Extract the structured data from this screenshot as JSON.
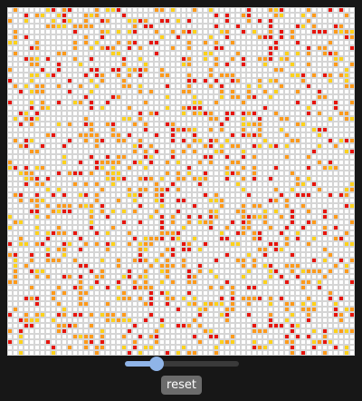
{
  "grid": {
    "rows": 64,
    "cols": 64,
    "density": 0.3,
    "seed": 7,
    "colors": {
      "empty": "#ffffff",
      "grid_line": "#d5d5d5",
      "red": "#e8140c",
      "orange": "#ff9a1a",
      "yellow": "#ffd21a"
    }
  },
  "controls": {
    "speed_level": 0.28,
    "reset_label": "reset"
  }
}
